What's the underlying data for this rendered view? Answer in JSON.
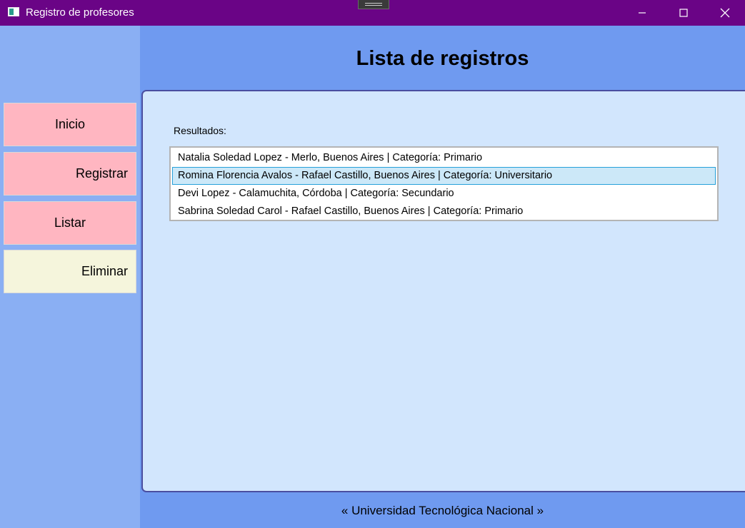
{
  "window": {
    "title": "Registro de profesores",
    "colors": {
      "titlebar": "#6a0486",
      "content": "#6f9af0",
      "sidebar": "#8aaff3",
      "panel": "#d2e6fd",
      "nav_button": "#ffb6c1",
      "nav_button_active": "#f5f5dc",
      "selection": "#cce8f8"
    }
  },
  "sidebar": {
    "items": [
      {
        "label": "Inicio",
        "icon": null
      },
      {
        "label": "Registrar",
        "icon": null
      },
      {
        "label": "Listar",
        "icon": null
      },
      {
        "label": "Eliminar",
        "icon": null
      }
    ]
  },
  "main": {
    "title": "Lista de registros",
    "results_label": "Resultados:",
    "records": [
      "Natalia Soledad Lopez - Merlo, Buenos Aires | Categoría: Primario",
      "Romina Florencia Avalos - Rafael Castillo, Buenos Aires | Categoría: Universitario",
      "Devi Lopez - Calamuchita, Córdoba | Categoría: Secundario",
      "Sabrina Soledad Carol - Rafael Castillo, Buenos Aires | Categoría: Primario"
    ],
    "selected_index": 1
  },
  "footer": {
    "text": "« Universidad Tecnológica Nacional »"
  },
  "icons": {
    "app": "app-window-icon",
    "minimize": "minimize-icon",
    "maximize": "maximize-icon",
    "close": "close-icon"
  }
}
